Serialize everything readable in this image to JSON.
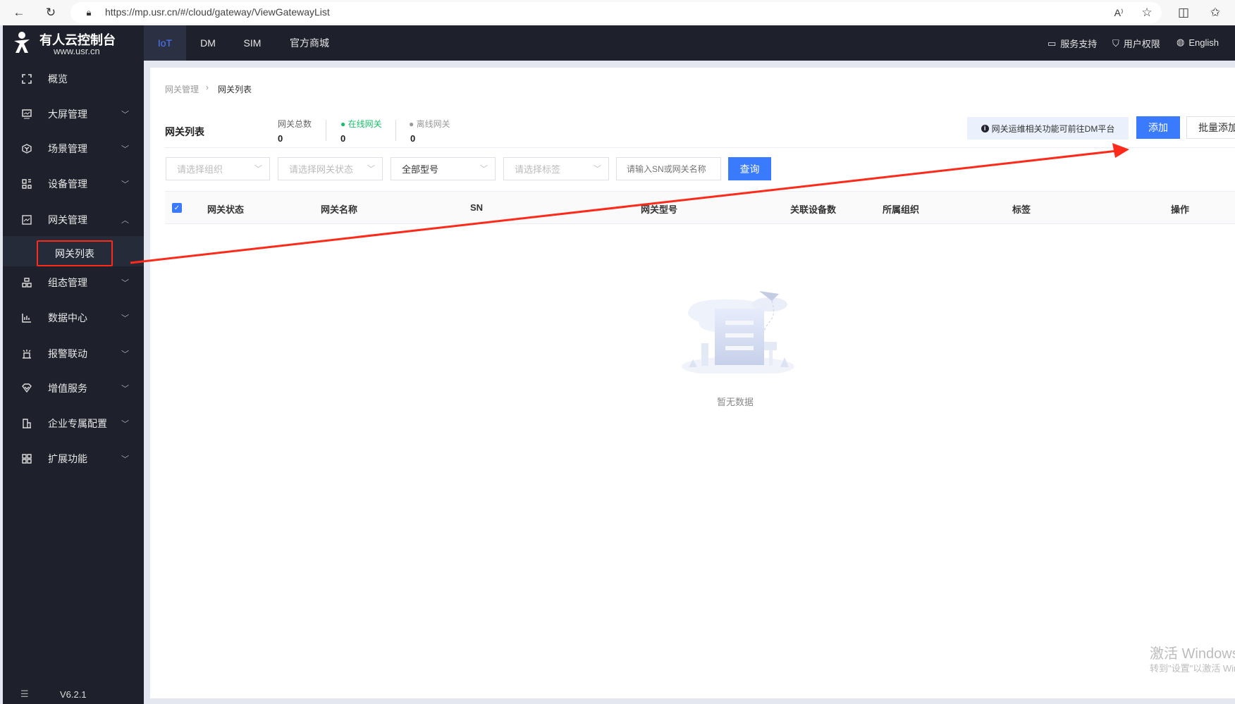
{
  "browser": {
    "url": "https://mp.usr.cn/#/cloud/gateway/ViewGatewayList"
  },
  "logo": {
    "title": "有人云控制台",
    "subtitle": "www.usr.cn"
  },
  "topnav": {
    "tabs": [
      {
        "label": "IoT",
        "active": true
      },
      {
        "label": "DM"
      },
      {
        "label": "SIM"
      },
      {
        "label": "官方商城"
      }
    ],
    "right": [
      {
        "label": "服务支持",
        "icon": "chat-icon"
      },
      {
        "label": "用户权限",
        "icon": "shield-icon"
      },
      {
        "label": "English",
        "icon": "globe-icon"
      }
    ]
  },
  "sidebar": {
    "items": [
      {
        "label": "概览",
        "icon": "overview-icon"
      },
      {
        "label": "大屏管理",
        "icon": "screen-icon"
      },
      {
        "label": "场景管理",
        "icon": "cube-icon"
      },
      {
        "label": "设备管理",
        "icon": "devices-icon"
      },
      {
        "label": "网关管理",
        "icon": "gateway-icon",
        "expanded": true
      },
      {
        "label": "组态管理",
        "icon": "topology-icon"
      },
      {
        "label": "数据中心",
        "icon": "chart-icon"
      },
      {
        "label": "报警联动",
        "icon": "alarm-icon"
      },
      {
        "label": "增值服务",
        "icon": "diamond-icon"
      },
      {
        "label": "企业专属配置",
        "icon": "building-icon"
      },
      {
        "label": "扩展功能",
        "icon": "grid-icon"
      }
    ],
    "subitem": "网关列表",
    "version": "V6.2.1"
  },
  "breadcrumb": [
    "网关管理",
    "网关列表"
  ],
  "page": {
    "title": "网关列表",
    "stats": [
      {
        "label": "网关总数",
        "value": "0"
      },
      {
        "label": "在线网关",
        "value": "0",
        "color": "#19be6b"
      },
      {
        "label": "离线网关",
        "value": "0",
        "color": "#999999"
      }
    ],
    "info": "网关运维相关功能可前往DM平台",
    "add": "添加",
    "batch_add": "批量添加"
  },
  "filters": {
    "org": "请选择组织",
    "status": "请选择网关状态",
    "model": "全部型号",
    "tag": "请选择标签",
    "search_placeholder": "请输入SN或网关名称",
    "query": "查询"
  },
  "table": {
    "columns": [
      "网关状态",
      "网关名称",
      "SN",
      "网关型号",
      "关联设备数",
      "所属组织",
      "标签",
      "操作"
    ],
    "empty": "暂无数据"
  },
  "watermark": {
    "line1": "激活 Windows",
    "line2": "转到\"设置\"以激活 Windows。"
  },
  "colors": {
    "accent": "#3a7bfd",
    "nav_bg": "#1e212b",
    "annotation": "#ff2a1a"
  }
}
